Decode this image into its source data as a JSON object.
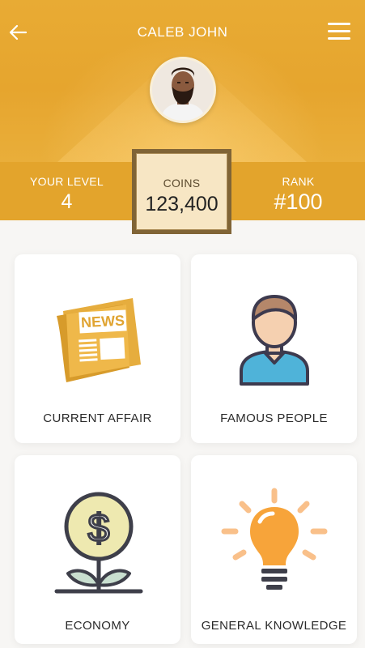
{
  "header": {
    "title": "CALEB JOHN",
    "back_icon": "arrow-left-icon",
    "menu_icon": "hamburger-menu-icon",
    "avatar": "user-avatar-photo"
  },
  "stats": {
    "level": {
      "label": "YOUR LEVEL",
      "value": "4"
    },
    "coins": {
      "label": "COINS",
      "value": "123,400"
    },
    "rank": {
      "label": "RANK",
      "value": "#100"
    }
  },
  "categories": [
    {
      "label": "CURRENT AFFAIR",
      "icon": "newspaper-icon"
    },
    {
      "label": "FAMOUS PEOPLE",
      "icon": "person-icon"
    },
    {
      "label": "ECONOMY",
      "icon": "money-plant-icon"
    },
    {
      "label": "GENERAL KNOWLEDGE",
      "icon": "lightbulb-icon"
    }
  ],
  "icon_text": {
    "news": "NEWS"
  },
  "colors": {
    "header": "#e6a52e",
    "stats_bar": "#e3a42c",
    "coins_border": "#806436",
    "coins_bg": "#f7e6c4",
    "card_bg": "#ffffff"
  }
}
